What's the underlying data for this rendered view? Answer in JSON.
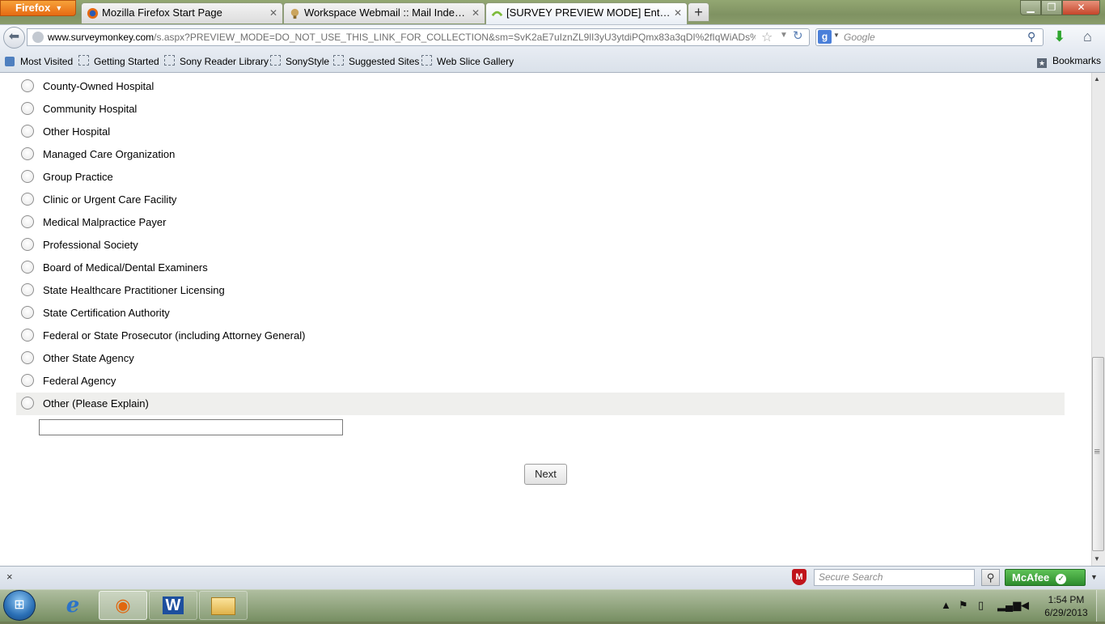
{
  "browser": {
    "menu_button": "Firefox",
    "tabs": [
      {
        "label": "Mozilla Firefox Start Page"
      },
      {
        "label": "Workspace Webmail :: Mail Index :: H..."
      },
      {
        "label": "[SURVEY PREVIEW MODE] Entity Surv..."
      }
    ],
    "new_tab": "+",
    "url_domain": "www.surveymonkey.com",
    "url_rest": "/s.aspx?PREVIEW_MODE=DO_NOT_USE_THIS_LINK_FOR_COLLECTION&sm=SvK2aE7uIznZL9lI3yU3ytdiPQmx83a3qDI%2fIqWiADs%3d",
    "search_engine_icon": "g",
    "search_placeholder": "Google",
    "bookmarks": [
      "Most Visited",
      "Getting Started",
      "Sony Reader Library",
      "SonyStyle",
      "Suggested Sites",
      "Web Slice Gallery"
    ],
    "bookmarks_menu": "Bookmarks"
  },
  "survey": {
    "options": [
      "County-Owned Hospital",
      "Community Hospital",
      "Other Hospital",
      "Managed Care Organization",
      "Group Practice",
      "Clinic or Urgent Care Facility",
      "Medical Malpractice Payer",
      "Professional Society",
      "Board of Medical/Dental Examiners",
      "State Healthcare Practitioner Licensing",
      "State Certification Authority",
      "Federal or State Prosecutor (including Attorney General)",
      "Other State Agency",
      "Federal Agency",
      "Other (Please Explain)"
    ],
    "other_text_value": "",
    "next_label": "Next"
  },
  "addon_bar": {
    "close": "×",
    "secure_search_placeholder": "Secure Search",
    "mcafee_label": "McAfee",
    "shield_letter": "M"
  },
  "taskbar": {
    "time": "1:54 PM",
    "date": "6/29/2013",
    "word_letter": "W"
  }
}
